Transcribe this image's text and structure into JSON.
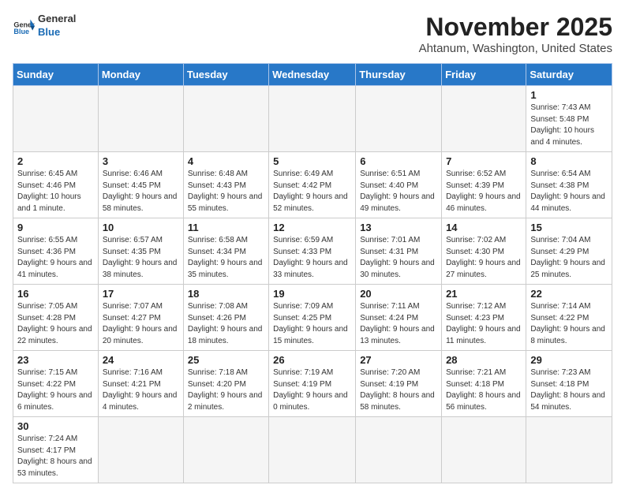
{
  "header": {
    "logo_line1": "General",
    "logo_line2": "Blue",
    "title": "November 2025",
    "subtitle": "Ahtanum, Washington, United States"
  },
  "weekdays": [
    "Sunday",
    "Monday",
    "Tuesday",
    "Wednesday",
    "Thursday",
    "Friday",
    "Saturday"
  ],
  "weeks": [
    [
      {
        "day": null
      },
      {
        "day": null
      },
      {
        "day": null
      },
      {
        "day": null
      },
      {
        "day": null
      },
      {
        "day": null
      },
      {
        "day": "1",
        "sunrise": "7:43 AM",
        "sunset": "5:48 PM",
        "daylight": "10 hours and 4 minutes."
      }
    ],
    [
      {
        "day": "2",
        "sunrise": "6:45 AM",
        "sunset": "4:46 PM",
        "daylight": "10 hours and 1 minute."
      },
      {
        "day": "3",
        "sunrise": "6:46 AM",
        "sunset": "4:45 PM",
        "daylight": "9 hours and 58 minutes."
      },
      {
        "day": "4",
        "sunrise": "6:48 AM",
        "sunset": "4:43 PM",
        "daylight": "9 hours and 55 minutes."
      },
      {
        "day": "5",
        "sunrise": "6:49 AM",
        "sunset": "4:42 PM",
        "daylight": "9 hours and 52 minutes."
      },
      {
        "day": "6",
        "sunrise": "6:51 AM",
        "sunset": "4:40 PM",
        "daylight": "9 hours and 49 minutes."
      },
      {
        "day": "7",
        "sunrise": "6:52 AM",
        "sunset": "4:39 PM",
        "daylight": "9 hours and 46 minutes."
      },
      {
        "day": "8",
        "sunrise": "6:54 AM",
        "sunset": "4:38 PM",
        "daylight": "9 hours and 44 minutes."
      }
    ],
    [
      {
        "day": "9",
        "sunrise": "6:55 AM",
        "sunset": "4:36 PM",
        "daylight": "9 hours and 41 minutes."
      },
      {
        "day": "10",
        "sunrise": "6:57 AM",
        "sunset": "4:35 PM",
        "daylight": "9 hours and 38 minutes."
      },
      {
        "day": "11",
        "sunrise": "6:58 AM",
        "sunset": "4:34 PM",
        "daylight": "9 hours and 35 minutes."
      },
      {
        "day": "12",
        "sunrise": "6:59 AM",
        "sunset": "4:33 PM",
        "daylight": "9 hours and 33 minutes."
      },
      {
        "day": "13",
        "sunrise": "7:01 AM",
        "sunset": "4:31 PM",
        "daylight": "9 hours and 30 minutes."
      },
      {
        "day": "14",
        "sunrise": "7:02 AM",
        "sunset": "4:30 PM",
        "daylight": "9 hours and 27 minutes."
      },
      {
        "day": "15",
        "sunrise": "7:04 AM",
        "sunset": "4:29 PM",
        "daylight": "9 hours and 25 minutes."
      }
    ],
    [
      {
        "day": "16",
        "sunrise": "7:05 AM",
        "sunset": "4:28 PM",
        "daylight": "9 hours and 22 minutes."
      },
      {
        "day": "17",
        "sunrise": "7:07 AM",
        "sunset": "4:27 PM",
        "daylight": "9 hours and 20 minutes."
      },
      {
        "day": "18",
        "sunrise": "7:08 AM",
        "sunset": "4:26 PM",
        "daylight": "9 hours and 18 minutes."
      },
      {
        "day": "19",
        "sunrise": "7:09 AM",
        "sunset": "4:25 PM",
        "daylight": "9 hours and 15 minutes."
      },
      {
        "day": "20",
        "sunrise": "7:11 AM",
        "sunset": "4:24 PM",
        "daylight": "9 hours and 13 minutes."
      },
      {
        "day": "21",
        "sunrise": "7:12 AM",
        "sunset": "4:23 PM",
        "daylight": "9 hours and 11 minutes."
      },
      {
        "day": "22",
        "sunrise": "7:14 AM",
        "sunset": "4:22 PM",
        "daylight": "9 hours and 8 minutes."
      }
    ],
    [
      {
        "day": "23",
        "sunrise": "7:15 AM",
        "sunset": "4:22 PM",
        "daylight": "9 hours and 6 minutes."
      },
      {
        "day": "24",
        "sunrise": "7:16 AM",
        "sunset": "4:21 PM",
        "daylight": "9 hours and 4 minutes."
      },
      {
        "day": "25",
        "sunrise": "7:18 AM",
        "sunset": "4:20 PM",
        "daylight": "9 hours and 2 minutes."
      },
      {
        "day": "26",
        "sunrise": "7:19 AM",
        "sunset": "4:19 PM",
        "daylight": "9 hours and 0 minutes."
      },
      {
        "day": "27",
        "sunrise": "7:20 AM",
        "sunset": "4:19 PM",
        "daylight": "8 hours and 58 minutes."
      },
      {
        "day": "28",
        "sunrise": "7:21 AM",
        "sunset": "4:18 PM",
        "daylight": "8 hours and 56 minutes."
      },
      {
        "day": "29",
        "sunrise": "7:23 AM",
        "sunset": "4:18 PM",
        "daylight": "8 hours and 54 minutes."
      }
    ],
    [
      {
        "day": "30",
        "sunrise": "7:24 AM",
        "sunset": "4:17 PM",
        "daylight": "8 hours and 53 minutes."
      },
      {
        "day": null
      },
      {
        "day": null
      },
      {
        "day": null
      },
      {
        "day": null
      },
      {
        "day": null
      },
      {
        "day": null
      }
    ]
  ],
  "labels": {
    "sunrise_prefix": "Sunrise: ",
    "sunset_prefix": "Sunset: ",
    "daylight_prefix": "Daylight: "
  }
}
